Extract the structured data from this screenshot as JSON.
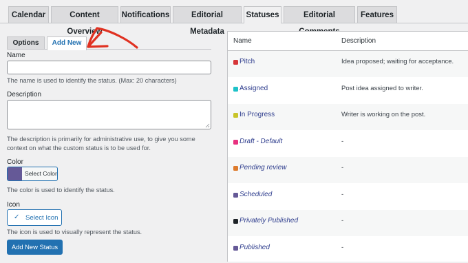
{
  "top_tabs": [
    "Calendar",
    "Content Overview",
    "Notifications",
    "Editorial Metadata",
    "Statuses",
    "Editorial Comments",
    "Features"
  ],
  "sub_tabs": [
    "Options",
    "Add New"
  ],
  "form": {
    "name_label": "Name",
    "name_value": "",
    "name_help": "The name is used to identify the status. (Max: 20 characters)",
    "description_label": "Description",
    "description_value": "",
    "description_help_1": "The description is primarily for administrative use, to give you some",
    "description_help_2": "context on what the custom status is to be used for.",
    "color_label": "Color",
    "color_button": "Select Color",
    "color_value": "#655997",
    "color_help": "The color is used to identify the status.",
    "icon_label": "Icon",
    "icon_button": "Select Icon",
    "icon_help": "The icon is used to visually represent the status.",
    "submit": "Add New Status"
  },
  "table": {
    "headers": [
      "Name",
      "Description"
    ],
    "rows": [
      {
        "name": "Pitch",
        "italic": false,
        "color": "#d63638",
        "description": "Idea proposed; waiting for acceptance."
      },
      {
        "name": "Assigned",
        "italic": false,
        "color": "#1ec2c8",
        "description": "Post idea assigned to writer."
      },
      {
        "name": "In Progress",
        "italic": false,
        "color": "#c8c42a",
        "description": "Writer is working on the post."
      },
      {
        "name": "Draft - Default",
        "italic": true,
        "color": "#e8317f",
        "description": "-"
      },
      {
        "name": "Pending review",
        "italic": true,
        "color": "#dd7b2c",
        "description": "-"
      },
      {
        "name": "Scheduled",
        "italic": true,
        "color": "#655997",
        "description": "-"
      },
      {
        "name": "Privately Published",
        "italic": true,
        "color": "#1d2327",
        "description": "-"
      },
      {
        "name": "Published",
        "italic": true,
        "color": "#655997",
        "description": "-"
      }
    ]
  },
  "colors": {
    "accent": "#2271b1",
    "arrow": "#e03121"
  }
}
